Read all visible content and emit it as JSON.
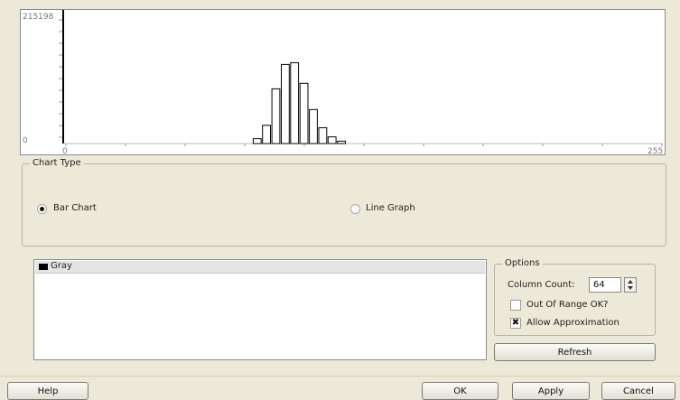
{
  "histogram": {
    "y_max_label": "215198",
    "y_min_label": "0",
    "x_min_label": "0",
    "x_max_label": "255"
  },
  "chart_data": {
    "type": "bar",
    "xlim": [
      0,
      255
    ],
    "ylim": [
      0,
      215198
    ],
    "bars": [
      {
        "x": 80,
        "value": 8000
      },
      {
        "x": 84,
        "value": 30000
      },
      {
        "x": 88,
        "value": 90000
      },
      {
        "x": 92,
        "value": 130000
      },
      {
        "x": 96,
        "value": 133000
      },
      {
        "x": 100,
        "value": 99000
      },
      {
        "x": 104,
        "value": 56000
      },
      {
        "x": 108,
        "value": 26000
      },
      {
        "x": 112,
        "value": 11000
      },
      {
        "x": 116,
        "value": 4000
      }
    ],
    "colors": {
      "bar_fill": "#ffffff",
      "bar_stroke": "#000000"
    }
  },
  "chart_type_group": {
    "title": "Chart Type",
    "bar_chart_label": "Bar Chart",
    "line_graph_label": "Line Graph",
    "selected": "Bar Chart"
  },
  "series": {
    "items": [
      {
        "label": "Gray",
        "color": "#000000"
      }
    ]
  },
  "options": {
    "title": "Options",
    "column_count_label": "Column Count:",
    "column_count_value": "64",
    "out_of_range_label": "Out Of Range OK?",
    "out_of_range_checked": false,
    "allow_approx_label": "Allow Approximation",
    "allow_approx_checked": true,
    "checked_glyph": "✖"
  },
  "buttons": {
    "refresh": "Refresh",
    "help": "Help",
    "ok": "OK",
    "apply": "Apply",
    "cancel": "Cancel"
  }
}
